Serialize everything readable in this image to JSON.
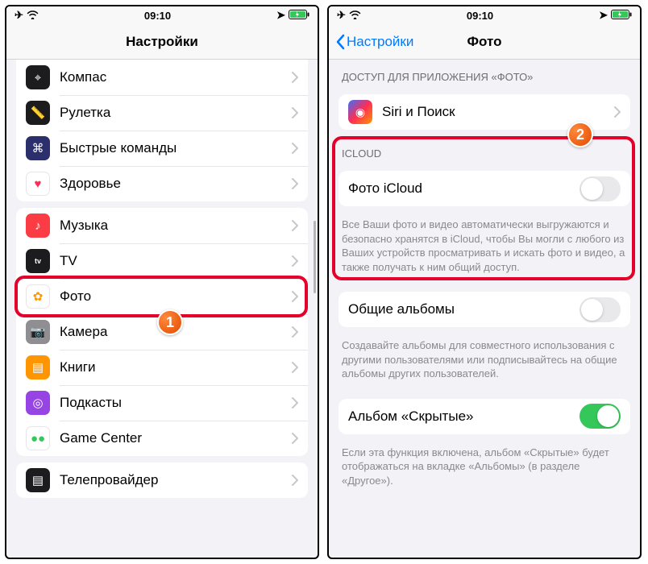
{
  "status": {
    "time": "09:10"
  },
  "left": {
    "title": "Настройки",
    "groups": [
      [
        {
          "key": "compass",
          "label": "Компас",
          "icon_bg": "#1c1c1e",
          "glyph": "⌖"
        },
        {
          "key": "measure",
          "label": "Рулетка",
          "icon_bg": "#1c1c1e",
          "glyph": "📏"
        },
        {
          "key": "shortcuts",
          "label": "Быстрые команды",
          "icon_bg": "#2b2f6b",
          "glyph": "⌘"
        },
        {
          "key": "health",
          "label": "Здоровье",
          "icon_bg": "#ffffff",
          "glyph": "♥",
          "glyph_color": "#ff2d55"
        }
      ],
      [
        {
          "key": "music",
          "label": "Музыка",
          "icon_bg": "#fc3c44",
          "glyph": "♪"
        },
        {
          "key": "tv",
          "label": "TV",
          "icon_bg": "#1c1c1e",
          "glyph": "tv",
          "small_text": true
        },
        {
          "key": "photos",
          "label": "Фото",
          "icon_bg": "#ffffff",
          "glyph": "✿",
          "glyph_color": "#ff9500",
          "highlight": true
        },
        {
          "key": "camera",
          "label": "Камера",
          "icon_bg": "#8e8e93",
          "glyph": "📷"
        },
        {
          "key": "books",
          "label": "Книги",
          "icon_bg": "#ff9500",
          "glyph": "▤"
        },
        {
          "key": "podcasts",
          "label": "Подкасты",
          "icon_bg": "#9644e3",
          "glyph": "◎"
        },
        {
          "key": "gamecenter",
          "label": "Game Center",
          "icon_bg": "#ffffff",
          "glyph": "●●",
          "glyph_color": "#34c759"
        }
      ],
      [
        {
          "key": "tvprovider",
          "label": "Телепровайдер",
          "icon_bg": "#1c1c1e",
          "glyph": "▤"
        }
      ]
    ],
    "step_badge": "1"
  },
  "right": {
    "back_label": "Настройки",
    "title": "Фото",
    "step_badge": "2",
    "sections": [
      {
        "header": "ДОСТУП ДЛЯ ПРИЛОЖЕНИЯ «ФОТО»",
        "rows": [
          {
            "key": "siri",
            "label": "Siri и Поиск",
            "type": "disclosure",
            "icon_bg": "linear-gradient(135deg,#3a6fff,#ff2d55,#ff9500)",
            "glyph": "◉"
          }
        ]
      },
      {
        "header": "ICLOUD",
        "highlight": true,
        "rows": [
          {
            "key": "icloud_photos",
            "label": "Фото iCloud",
            "type": "toggle",
            "value": false
          }
        ],
        "footer": "Все Ваши фото и видео автоматически выгружаются и безопасно хранятся в iCloud, чтобы Вы могли с любого из Ваших устройств просматривать и искать фото и видео, а также получать к ним общий доступ."
      },
      {
        "rows": [
          {
            "key": "shared_albums",
            "label": "Общие альбомы",
            "type": "toggle",
            "value": false
          }
        ],
        "footer": "Создавайте альбомы для совместного использования с другими пользователями или подписывайтесь на общие альбомы других пользователей."
      },
      {
        "rows": [
          {
            "key": "hidden_album",
            "label": "Альбом «Скрытые»",
            "type": "toggle",
            "value": true
          }
        ],
        "footer": "Если эта функция включена, альбом «Скрытые» будет отображаться на вкладке «Альбомы» (в разделе «Другое»)."
      }
    ]
  }
}
